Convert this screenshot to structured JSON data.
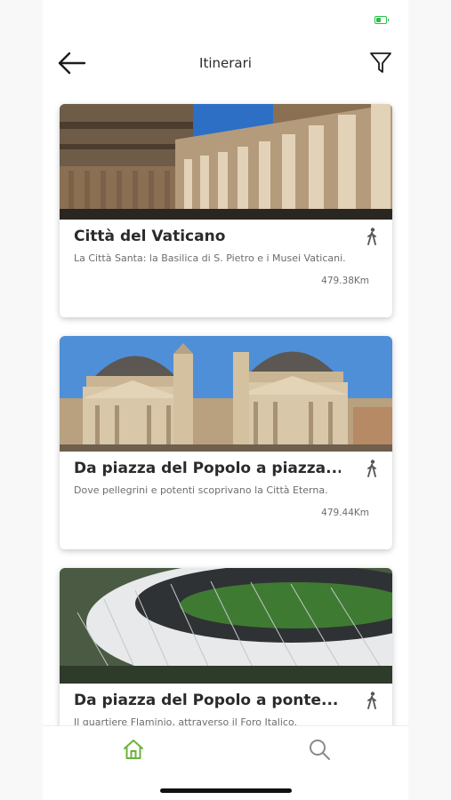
{
  "header": {
    "title": "Itinerari",
    "back_icon": "arrow-left-icon",
    "filter_icon": "filter-icon"
  },
  "itineraries": [
    {
      "title": "Città del Vaticano",
      "description": "La Città Santa: la Basilica di S. Pietro e i Musei Vaticani.",
      "distance": "479.38Km",
      "mode_icon": "walking-person-icon"
    },
    {
      "title": "Da piazza del Popolo a piazza...",
      "description": "Dove pellegrini e potenti scoprivano la Città Eterna.",
      "distance": "479.44Km",
      "mode_icon": "walking-person-icon"
    },
    {
      "title": "Da piazza del Popolo a ponte...",
      "description": "Il quartiere Flaminio, attraverso il Foro Italico.",
      "distance": "",
      "mode_icon": "walking-person-icon"
    }
  ],
  "tabbar": {
    "tabs": [
      {
        "icon": "home-icon",
        "active": true
      },
      {
        "icon": "search-icon",
        "active": false
      }
    ]
  },
  "colors": {
    "accent": "#6bb33a",
    "battery": "#26c244",
    "text_primary": "#2b2b2b",
    "text_secondary": "#6d6d6d"
  }
}
